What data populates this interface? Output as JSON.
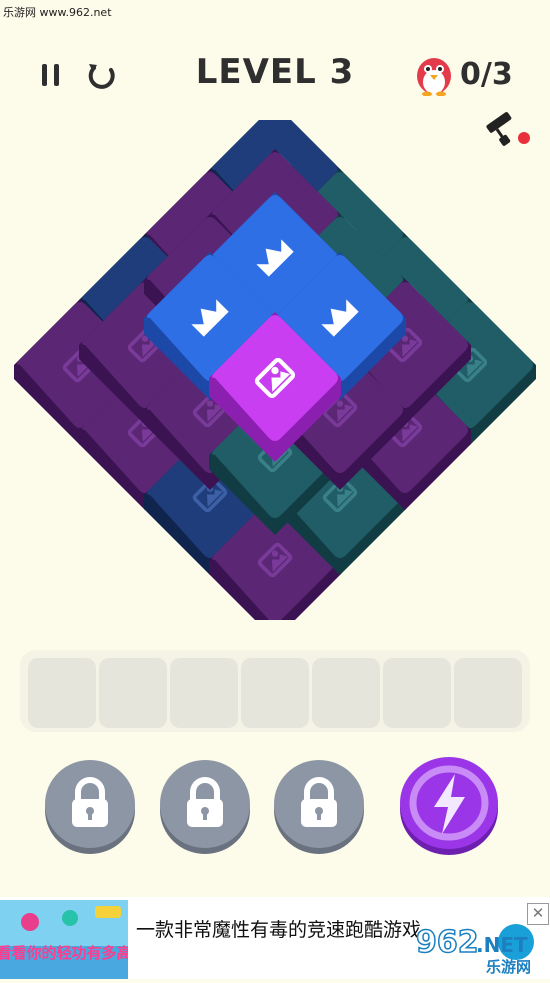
{
  "watermark": "乐游网 www.962.net",
  "header": {
    "level_title": "LEVEL 3",
    "penguin_count": "0/3"
  },
  "icons": {
    "pause": "pause-icon",
    "restart": "restart-icon",
    "penguin": "penguin-icon",
    "paint": "paint-roller-icon",
    "lock": "lock-icon",
    "lightning": "lightning-icon",
    "crown": "crown-icon",
    "image": "image-icon"
  },
  "colors": {
    "background": "#fdfbe9",
    "purple_tile": "#5b2774",
    "teal_tile": "#205d66",
    "navy_tile": "#1f3d7a",
    "blue_tile": "#2f6fe6",
    "magenta_tile": "#c93ef0",
    "lightning_button": "#9a35e8",
    "lock_button": "#808a99"
  },
  "tray": {
    "slots": 7,
    "filled": 0
  },
  "powerups": [
    {
      "name": "locked-powerup-1",
      "state": "locked"
    },
    {
      "name": "locked-powerup-2",
      "state": "locked"
    },
    {
      "name": "locked-powerup-3",
      "state": "locked"
    },
    {
      "name": "lightning-powerup",
      "state": "active"
    }
  ],
  "ad": {
    "headline": "一款非常魔性有毒的竞速跑酷游戏",
    "close_label": "✕",
    "thumb_caption": "看看你的轻功有多高",
    "logo_number": "962",
    "logo_suffix": ".NET",
    "logo_subtitle": "乐游网"
  }
}
